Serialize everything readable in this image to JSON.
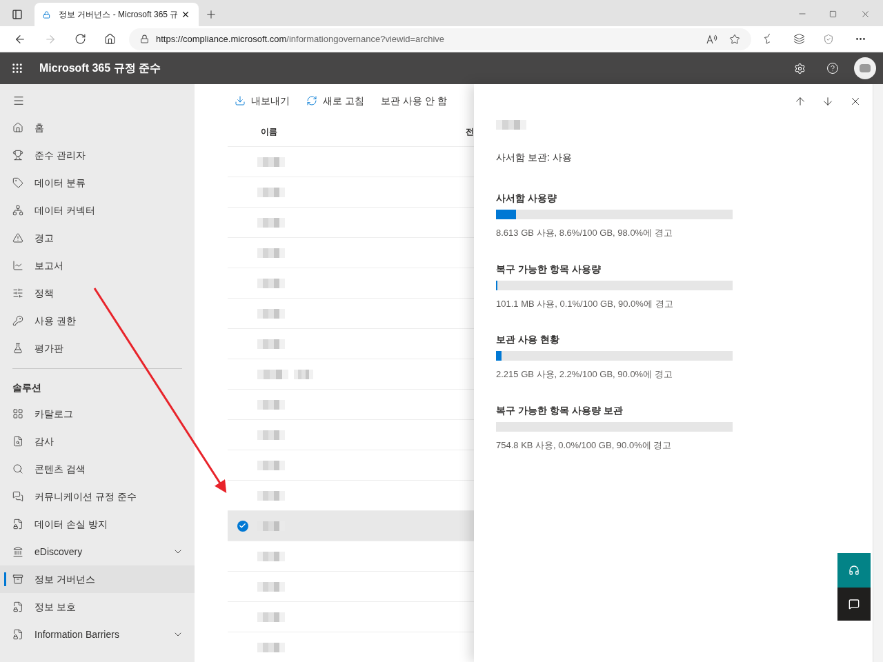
{
  "browser": {
    "tab_title": "정보 거버넌스 - Microsoft 365 규",
    "url_host": "https://compliance.microsoft.com",
    "url_path": "/informationgovernance?viewid=archive",
    "forward_disabled": true
  },
  "app_header": {
    "title": "Microsoft 365 규정 준수"
  },
  "sidebar": {
    "items": [
      {
        "label": "홈",
        "selected": false,
        "has_submenu": false
      },
      {
        "label": "준수 관리자",
        "selected": false,
        "has_submenu": false
      },
      {
        "label": "데이터 분류",
        "selected": false,
        "has_submenu": false
      },
      {
        "label": "데이터 커넥터",
        "selected": false,
        "has_submenu": false
      },
      {
        "label": "경고",
        "selected": false,
        "has_submenu": false
      },
      {
        "label": "보고서",
        "selected": false,
        "has_submenu": false
      },
      {
        "label": "정책",
        "selected": false,
        "has_submenu": false
      },
      {
        "label": "사용 권한",
        "selected": false,
        "has_submenu": false
      },
      {
        "label": "평가판",
        "selected": false,
        "has_submenu": false
      }
    ],
    "section_title": "솔루션",
    "solutions": [
      {
        "label": "카탈로그",
        "selected": false,
        "has_submenu": false
      },
      {
        "label": "감사",
        "selected": false,
        "has_submenu": false
      },
      {
        "label": "콘텐츠 검색",
        "selected": false,
        "has_submenu": false
      },
      {
        "label": "커뮤니케이션 규정 준수",
        "selected": false,
        "has_submenu": false
      },
      {
        "label": "데이터 손실 방지",
        "selected": false,
        "has_submenu": false
      },
      {
        "label": "eDiscovery",
        "selected": false,
        "has_submenu": true
      },
      {
        "label": "정보 거버넌스",
        "selected": true,
        "has_submenu": false
      },
      {
        "label": "정보 보호",
        "selected": false,
        "has_submenu": false
      },
      {
        "label": "Information Barriers",
        "selected": false,
        "has_submenu": true
      }
    ]
  },
  "toolbar": [
    {
      "label": "내보내기"
    },
    {
      "label": "새로 고침"
    },
    {
      "label": "보관 사용 안 함"
    }
  ],
  "table": {
    "columns": [
      "이름",
      "전"
    ],
    "rows": [
      {
        "selected": false
      },
      {
        "selected": false
      },
      {
        "selected": false
      },
      {
        "selected": false
      },
      {
        "selected": false
      },
      {
        "selected": false
      },
      {
        "selected": false
      },
      {
        "selected": false
      },
      {
        "selected": false
      },
      {
        "selected": false
      },
      {
        "selected": false
      },
      {
        "selected": false
      },
      {
        "selected": true
      },
      {
        "selected": false
      },
      {
        "selected": false
      },
      {
        "selected": false
      },
      {
        "selected": false
      }
    ]
  },
  "details": {
    "subtitle": "사서함 보관: 사용",
    "meters": [
      {
        "title": "사서함 사용량",
        "level": 0.086,
        "reading": "8.613 GB 사용, 8.6%/100 GB, 98.0%에 경고"
      },
      {
        "title": "복구 가능한 항목 사용량",
        "level": 0.001,
        "reading": "101.1 MB 사용, 0.1%/100 GB, 90.0%에 경고"
      },
      {
        "title": "보관 사용 현황",
        "level": 0.022,
        "reading": "2.215 GB 사용, 2.2%/100 GB, 90.0%에 경고"
      },
      {
        "title": "복구 가능한 항목 사용량 보관",
        "level": 0.0,
        "reading": "754.8 KB 사용, 0.0%/100 GB, 90.0%에 경고"
      }
    ]
  }
}
